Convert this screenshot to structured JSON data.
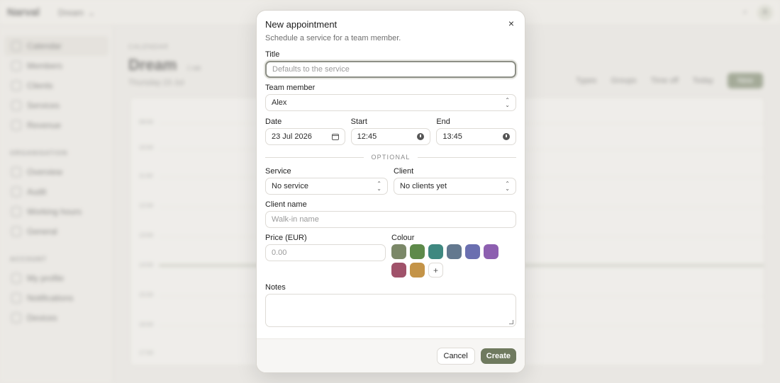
{
  "app": {
    "brand": "Narval",
    "workspace": "Dream",
    "avatar_initial": "A"
  },
  "sidebar": {
    "items": [
      {
        "label": "Calendar"
      },
      {
        "label": "Members"
      },
      {
        "label": "Clients"
      },
      {
        "label": "Services"
      },
      {
        "label": "Revenue"
      }
    ],
    "section_org": "ORGANISATION",
    "org_items": [
      {
        "label": "Overview"
      },
      {
        "label": "Audit"
      },
      {
        "label": "Working hours"
      },
      {
        "label": "General"
      }
    ],
    "section_account": "ACCOUNT",
    "account_items": [
      {
        "label": "My profile"
      },
      {
        "label": "Notifications"
      },
      {
        "label": "Devices"
      }
    ]
  },
  "main": {
    "eyebrow": "CALENDAR",
    "title": "Dream",
    "title_meta": "1 tab",
    "date_label": "Thursday 23 Jul",
    "toolbar": [
      "Types",
      "Groups",
      "Time off",
      "Today"
    ],
    "new_label": "New",
    "hours": [
      "09:00",
      "10:00",
      "11:00",
      "12:00",
      "13:00",
      "14:00",
      "15:00",
      "16:00",
      "17:00"
    ]
  },
  "modal": {
    "title": "New appointment",
    "subtitle": "Schedule a service for a team member.",
    "close_glyph": "×",
    "title_field": {
      "label": "Title",
      "placeholder": "Defaults to the service"
    },
    "team_member": {
      "label": "Team member",
      "value": "Alex"
    },
    "date": {
      "label": "Date",
      "value": "23 Jul 2026"
    },
    "start": {
      "label": "Start",
      "value": "12:45"
    },
    "end": {
      "label": "End",
      "value": "13:45"
    },
    "optional_label": "OPTIONAL",
    "service": {
      "label": "Service",
      "value": "No service"
    },
    "client": {
      "label": "Client",
      "value": "No clients yet"
    },
    "client_name": {
      "label": "Client name",
      "placeholder": "Walk-in name"
    },
    "price": {
      "label": "Price (EUR)",
      "placeholder": "0.00"
    },
    "colour": {
      "label": "Colour",
      "swatches": [
        "#7b8868",
        "#5e8a4a",
        "#3f8880",
        "#63788f",
        "#6a6fb0",
        "#8d5fb0",
        "#a0526a",
        "#c49448"
      ],
      "add_glyph": "+"
    },
    "notes": {
      "label": "Notes"
    },
    "cancel_label": "Cancel",
    "create_label": "Create"
  }
}
